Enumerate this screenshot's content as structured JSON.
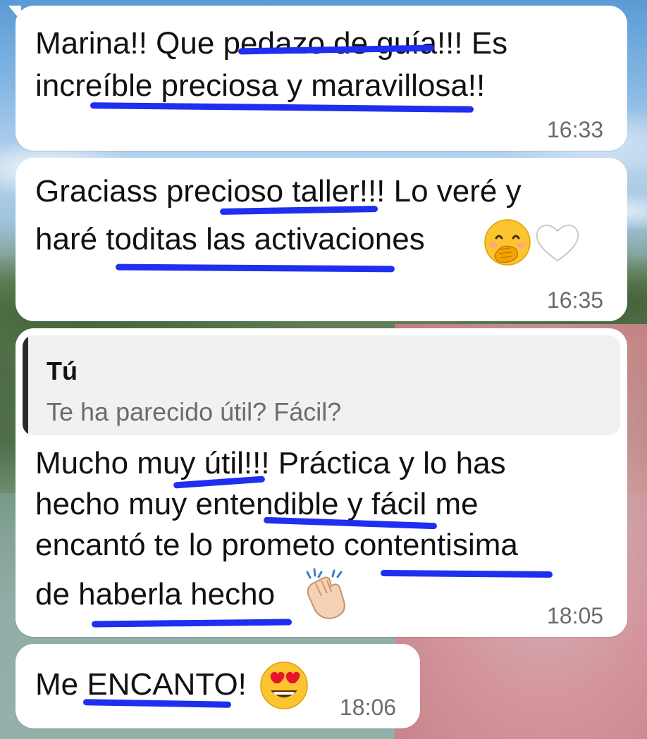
{
  "messages": [
    {
      "line1": "Marina!! Que pedazo de guía!!! Es",
      "line2": "increíble preciosa y maravillosa!!",
      "time": "16:33"
    },
    {
      "line1": "Graciass precioso taller!!! Lo veré y",
      "line2": "haré toditas las activaciones",
      "time": "16:35"
    },
    {
      "reply_author": "Tú",
      "reply_text": "Te ha parecido útil? Fácil?",
      "line1": "Mucho muy útil!!! Práctica y lo has",
      "line2": "hecho muy entendible y fácil me",
      "line3": "encantó te lo prometo contentisima",
      "line4": "de haberla hecho",
      "time": "18:05"
    },
    {
      "line1": "Me ENCANTO!",
      "time": "18:06"
    }
  ],
  "icons": [
    "smiling-hand-over-mouth-emoji",
    "white-heart-emoji",
    "clapping-hands-emoji",
    "heart-eyes-emoji"
  ],
  "colors": {
    "bubble": "#ffffff",
    "underline_marker": "#1f2ff0",
    "timestamp": "#6b6b6b",
    "reply_bg": "#f1f1f1"
  }
}
